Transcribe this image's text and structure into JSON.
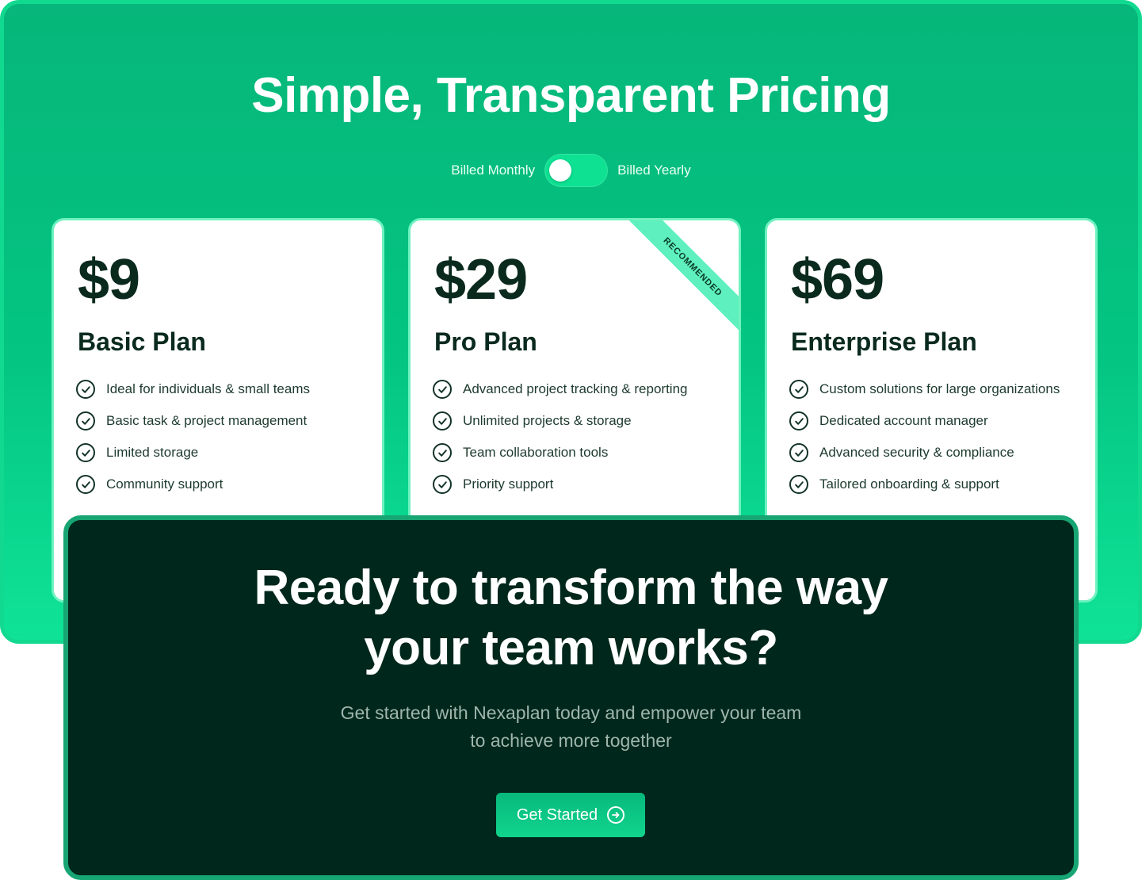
{
  "pricing": {
    "title": "Simple, Transparent Pricing",
    "billing_monthly": "Billed Monthly",
    "billing_yearly": "Billed Yearly",
    "toggle_state": "monthly"
  },
  "plans": [
    {
      "price": "$9",
      "name": "Basic Plan",
      "features": [
        "Ideal for individuals & small teams",
        "Basic task & project management",
        "Limited storage",
        "Community support"
      ]
    },
    {
      "price": "$29",
      "name": "Pro Plan",
      "badge": "RECOMMENDED",
      "features": [
        "Advanced project tracking & reporting",
        "Unlimited projects & storage",
        "Team collaboration tools",
        "Priority support"
      ]
    },
    {
      "price": "$69",
      "name": "Enterprise Plan",
      "features": [
        "Custom solutions for large organizations",
        "Dedicated account manager",
        "Advanced security & compliance",
        "Tailored onboarding & support"
      ]
    }
  ],
  "cta": {
    "title_line1": "Ready to transform the way",
    "title_line2": "your team works?",
    "subtitle_line1": "Get started with Nexaplan today and empower your team",
    "subtitle_line2": "to achieve more together",
    "button_label": "Get Started",
    "button_icon": "arrow-right-circle-icon"
  },
  "colors": {
    "brand_green": "#04c582",
    "dark_green": "#00271b",
    "text_dark": "#0a2a1e"
  }
}
